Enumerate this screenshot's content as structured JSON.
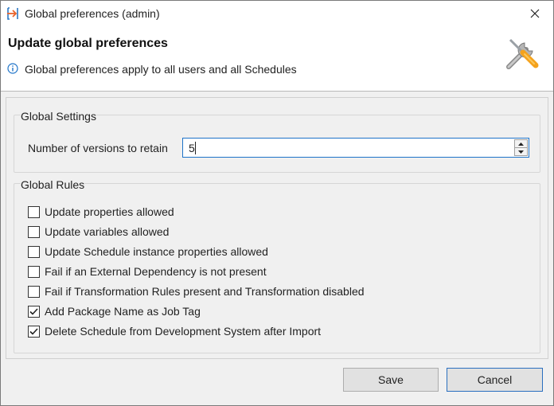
{
  "window": {
    "title": "Global preferences (admin)",
    "accent_color": "#e8632b"
  },
  "header": {
    "title": "Update global preferences",
    "message": "Global preferences apply to all users and all Schedules",
    "info_icon": "info-circle-icon",
    "banner_icon": "wrench-screwdriver-icon"
  },
  "global_settings": {
    "group_label": "Global Settings",
    "versions_label": "Number of versions to retain",
    "versions_value": "5"
  },
  "global_rules": {
    "group_label": "Global Rules",
    "items": [
      {
        "label": "Update properties allowed",
        "checked": false
      },
      {
        "label": "Update variables allowed",
        "checked": false
      },
      {
        "label": "Update Schedule instance properties allowed",
        "checked": false
      },
      {
        "label": "Fail if an External Dependency is not present",
        "checked": false
      },
      {
        "label": "Fail if Transformation Rules present and Transformation disabled",
        "checked": false
      },
      {
        "label": "Add Package Name as Job Tag",
        "checked": true
      },
      {
        "label": "Delete Schedule from Development System after Import",
        "checked": true
      }
    ]
  },
  "buttons": {
    "save_label": "Save",
    "cancel_label": "Cancel"
  }
}
